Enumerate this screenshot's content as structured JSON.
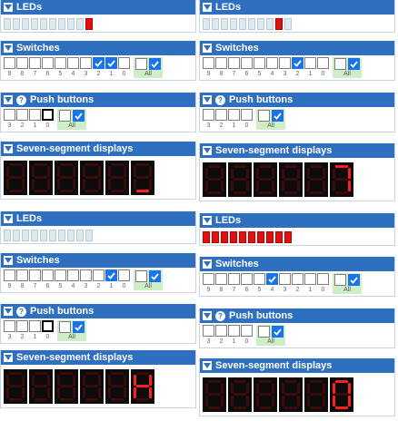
{
  "colors": {
    "header": "#2f6fbf",
    "led_on": "#e01010",
    "checkbox_on": "#1a73e8",
    "all_bg": "#cdeec6",
    "segment_on": "#ff1f1f"
  },
  "icons": {
    "collapse": "chevron-down-icon",
    "help": "help-circle-icon"
  },
  "labels": {
    "leds": "LEDs",
    "switches": "Switches",
    "push_buttons": "Push buttons",
    "seven_segment": "Seven-segment displays",
    "help": "?",
    "all": "All"
  },
  "switch_numbers": [
    "9",
    "8",
    "7",
    "6",
    "5",
    "4",
    "3",
    "2",
    "1",
    "0"
  ],
  "button_numbers": [
    "3",
    "2",
    "1",
    "0"
  ],
  "boards": [
    {
      "leds": [
        0,
        0,
        0,
        0,
        0,
        0,
        0,
        0,
        0,
        1
      ],
      "switches": [
        0,
        0,
        0,
        0,
        0,
        0,
        0,
        1,
        1,
        0
      ],
      "switches_all": [
        0,
        1
      ],
      "buttons": [
        0,
        0,
        0,
        0
      ],
      "buttons_pressed": [
        0,
        0,
        0,
        1
      ],
      "buttons_all": [
        0,
        1
      ],
      "segments": [
        [],
        [],
        [],
        [],
        [],
        [
          "d"
        ]
      ]
    },
    {
      "leds": [
        0,
        0,
        0,
        0,
        0,
        0,
        0,
        0,
        1,
        0
      ],
      "switches": [
        0,
        0,
        0,
        0,
        0,
        0,
        0,
        1,
        0,
        0
      ],
      "switches_all": [
        0,
        1
      ],
      "buttons": [
        0,
        0,
        0,
        0
      ],
      "buttons_pressed": [
        0,
        0,
        0,
        0
      ],
      "buttons_all": [
        0,
        1
      ],
      "segments": [
        [],
        [],
        [],
        [],
        [],
        [
          "a",
          "b",
          "c"
        ]
      ]
    },
    {
      "leds": [
        0,
        0,
        0,
        0,
        0,
        0,
        0,
        0,
        0,
        0
      ],
      "switches": [
        0,
        0,
        0,
        0,
        0,
        0,
        0,
        0,
        1,
        0
      ],
      "switches_all": [
        0,
        1
      ],
      "buttons": [
        0,
        0,
        0,
        0
      ],
      "buttons_pressed": [
        0,
        0,
        0,
        1
      ],
      "buttons_all": [
        0,
        1
      ],
      "segments": [
        [],
        [],
        [],
        [],
        [],
        [
          "b",
          "c",
          "e",
          "f",
          "g"
        ]
      ]
    },
    {
      "leds": [
        1,
        1,
        1,
        1,
        1,
        1,
        1,
        1,
        1,
        1
      ],
      "switches": [
        0,
        0,
        0,
        0,
        0,
        1,
        0,
        0,
        0,
        0
      ],
      "switches_all": [
        0,
        1
      ],
      "buttons": [
        0,
        0,
        0,
        0
      ],
      "buttons_pressed": [
        0,
        0,
        0,
        0
      ],
      "buttons_all": [
        0,
        1
      ],
      "segments": [
        [],
        [],
        [],
        [],
        [],
        [
          "a",
          "b",
          "c",
          "d",
          "e",
          "f"
        ]
      ]
    }
  ]
}
